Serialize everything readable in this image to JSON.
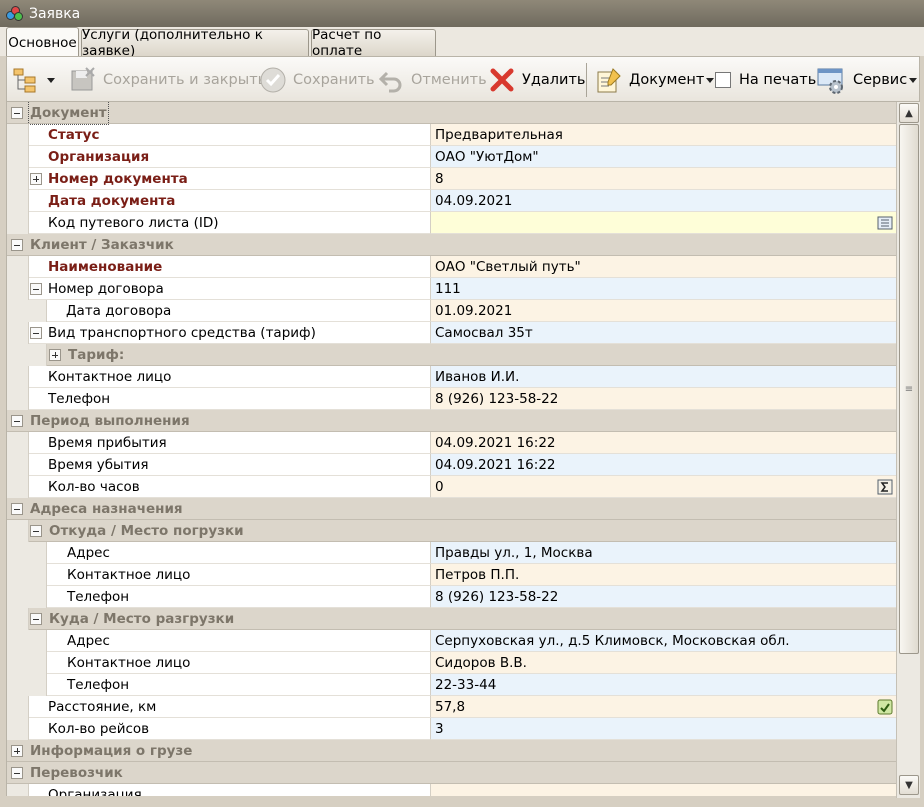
{
  "window": {
    "title": "Заявка"
  },
  "tabs": [
    {
      "label": "Основное",
      "active": true
    },
    {
      "label": "Услуги (дополнительно к заявке)",
      "active": false
    },
    {
      "label": "Расчет по оплате",
      "active": false
    }
  ],
  "toolbar": {
    "save_close": "Сохранить и закрыть",
    "save": "Сохранить",
    "cancel": "Отменить",
    "delete": "Удалить",
    "document": "Документ",
    "print": "На печать",
    "service": "Сервис"
  },
  "grid": {
    "doc_header": "Документ",
    "status_label": "Статус",
    "status_value": "Предварительная",
    "org_label": "Организация",
    "org_value": "ОАО \"УютДом\"",
    "docnum_label": "Номер документа",
    "docnum_value": "8",
    "docdate_label": "Дата документа",
    "docdate_value": "04.09.2021",
    "waybill_label": "Код путевого листа (ID)",
    "waybill_value": "",
    "client_header": "Клиент / Заказчик",
    "name_label": "Наименование",
    "name_value": "ОАО \"Светлый путь\"",
    "contract_label": "Номер договора",
    "contract_value": "111",
    "contract_date_label": "Дата договора",
    "contract_date_value": "01.09.2021",
    "vehicle_label": "Вид транспортного средства (тариф)",
    "vehicle_value": "Самосвал 35т",
    "tariff_label": "Тариф:",
    "contact_label": "Контактное лицо",
    "contact_value": "Иванов И.И.",
    "phone_label": "Телефон",
    "phone_value": "8 (926) 123-58-22",
    "period_header": "Период выполнения",
    "arrive_label": "Время прибытия",
    "arrive_value": "04.09.2021 16:22",
    "depart_label": "Время убытия",
    "depart_value": "04.09.2021 16:22",
    "hours_label": "Кол-во часов",
    "hours_value": "0",
    "addr_header": "Адреса назначения",
    "from_header": "Откуда / Место погрузки",
    "from_addr_label": "Адрес",
    "from_addr_value": "Правды ул., 1, Москва",
    "from_contact_label": "Контактное лицо",
    "from_contact_value": "Петров П.П.",
    "from_phone_label": "Телефон",
    "from_phone_value": "8 (926) 123-58-22",
    "to_header": "Куда / Место разгрузки",
    "to_addr_label": "Адрес",
    "to_addr_value": "Серпуховская ул., д.5 Климовск, Московская обл.",
    "to_contact_label": "Контактное лицо",
    "to_contact_value": "Сидоров В.В.",
    "to_phone_label": "Телефон",
    "to_phone_value": "22-33-44",
    "distance_label": "Расстояние, км",
    "distance_value": "57,8",
    "trips_label": "Кол-во рейсов",
    "trips_value": "3",
    "cargo_header": "Информация о грузе",
    "carrier_header": "Перевозчик",
    "carrier_org_label": "Организация"
  }
}
